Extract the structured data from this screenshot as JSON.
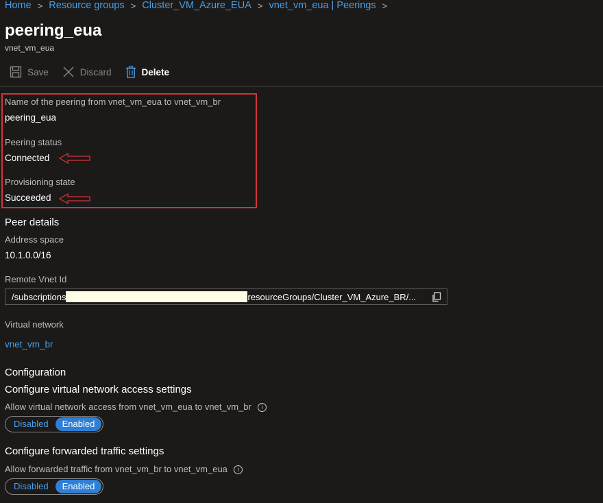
{
  "breadcrumb": {
    "items": [
      "Home",
      "Resource groups",
      "Cluster_VM_Azure_EUA",
      "vnet_vm_eua | Peerings"
    ],
    "separator": ">"
  },
  "header": {
    "title": "peering_eua",
    "subtitle": "vnet_vm_eua"
  },
  "toolbar": {
    "save_label": "Save",
    "discard_label": "Discard",
    "delete_label": "Delete"
  },
  "peering": {
    "name_label": "Name of the peering from vnet_vm_eua to vnet_vm_br",
    "name_value": "peering_eua",
    "status_label": "Peering status",
    "status_value": "Connected",
    "provisioning_label": "Provisioning state",
    "provisioning_value": "Succeeded"
  },
  "peer_details": {
    "heading": "Peer details",
    "address_space_label": "Address space",
    "address_space_value": "10.1.0.0/16",
    "remote_vnet_id_label": "Remote Vnet Id",
    "remote_vnet_id_prefix": "/subscriptions",
    "remote_vnet_id_suffix": "resourceGroups/Cluster_VM_Azure_BR/...",
    "virtual_network_label": "Virtual network",
    "virtual_network_value": "vnet_vm_br"
  },
  "configuration": {
    "heading": "Configuration",
    "access": {
      "heading": "Configure virtual network access settings",
      "label": "Allow virtual network access from vnet_vm_eua to vnet_vm_br",
      "options": [
        "Disabled",
        "Enabled"
      ],
      "selected": "Enabled"
    },
    "forwarded": {
      "heading": "Configure forwarded traffic settings",
      "label": "Allow forwarded traffic from vnet_vm_br to vnet_vm_eua",
      "options": [
        "Disabled",
        "Enabled"
      ],
      "selected": "Enabled"
    }
  },
  "colors": {
    "background": "#1b1a19",
    "link": "#4a9fe8",
    "highlight_border": "#d13438",
    "toggle_selected": "#2f7fd6"
  }
}
